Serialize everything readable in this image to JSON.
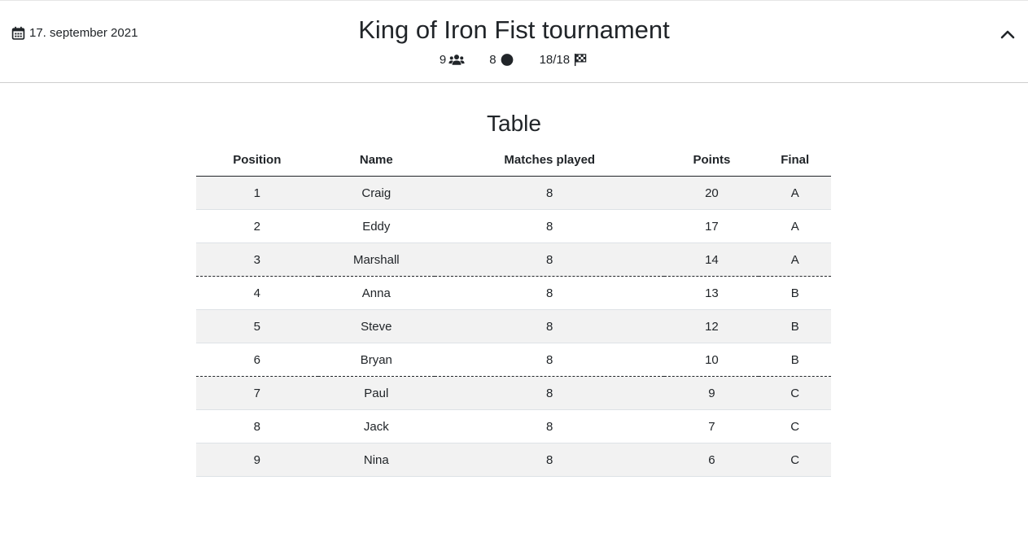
{
  "header": {
    "date": "17. september 2021",
    "title": "King of Iron Fist tournament",
    "stats": {
      "players": "9",
      "players_icon": "users-icon",
      "matches": "8",
      "matches_icon": "circle-icon",
      "progress": "18/18",
      "progress_icon": "checkered-flag-icon"
    },
    "collapse_icon": "chevron-up-icon"
  },
  "table": {
    "title": "Table",
    "columns": [
      "Position",
      "Name",
      "Matches played",
      "Points",
      "Final"
    ],
    "rows": [
      [
        "1",
        "Craig",
        "8",
        "20",
        "A"
      ],
      [
        "2",
        "Eddy",
        "8",
        "17",
        "A"
      ],
      [
        "3",
        "Marshall",
        "8",
        "14",
        "A"
      ],
      [
        "4",
        "Anna",
        "8",
        "13",
        "B"
      ],
      [
        "5",
        "Steve",
        "8",
        "12",
        "B"
      ],
      [
        "6",
        "Bryan",
        "8",
        "10",
        "B"
      ],
      [
        "7",
        "Paul",
        "8",
        "9",
        "C"
      ],
      [
        "8",
        "Jack",
        "8",
        "7",
        "C"
      ],
      [
        "9",
        "Nina",
        "8",
        "6",
        "C"
      ]
    ]
  }
}
